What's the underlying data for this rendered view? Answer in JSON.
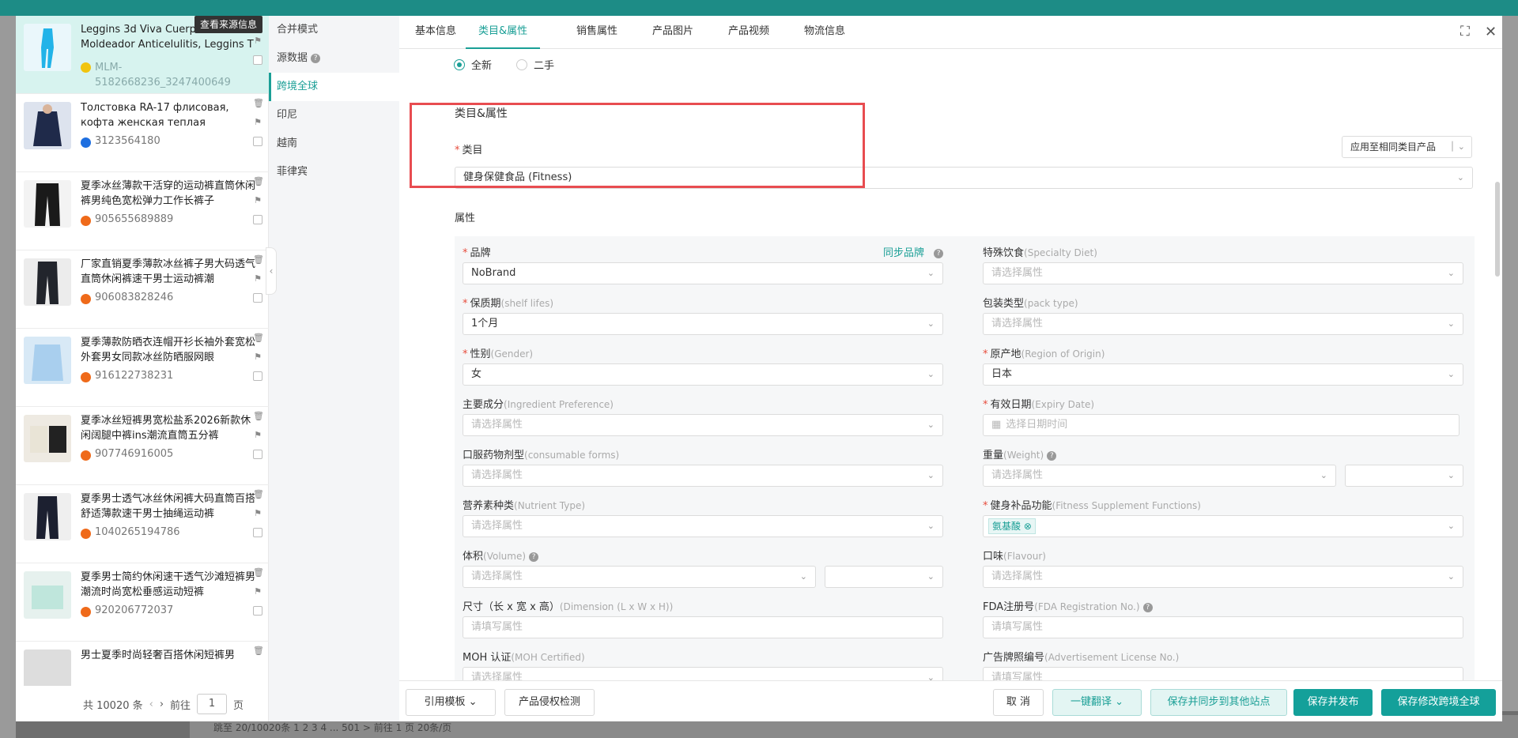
{
  "product_list": {
    "view_source_label": "查看来源信息",
    "items": [
      {
        "title": "Leggins 3d Viva Cuerpo Moldeador Anticelulitis, Leggins T",
        "id": "MLM-5182668236_3247400649",
        "active": true
      },
      {
        "title": "Толстовка RA-17 флисовая, кофта женская теплая",
        "id": "3123564180"
      },
      {
        "title": "夏季冰丝薄款干活穿的运动裤直筒休闲裤男纯色宽松弹力工作长裤子",
        "id": "905655689889"
      },
      {
        "title": "厂家直销夏季薄款冰丝裤子男大码透气直筒休闲裤速干男士运动裤潮",
        "id": "906083828246"
      },
      {
        "title": "夏季薄款防晒衣连帽开衫长袖外套宽松外套男女同款冰丝防晒服网眼",
        "id": "916122738231"
      },
      {
        "title": "夏季冰丝短裤男宽松盐系2026新款休闲阔腿中裤ins潮流直筒五分裤",
        "id": "907746916005"
      },
      {
        "title": "夏季男士透气冰丝休闲裤大码直筒百搭舒适薄款速干男士抽绳运动裤",
        "id": "1040265194786"
      },
      {
        "title": "夏季男士简约休闲速干透气沙滩短裤男潮流时尚宽松垂感运动短裤",
        "id": "920206772037"
      },
      {
        "title": "男士夏季时尚轻奢百搭休闲短裤男",
        "id": ""
      }
    ],
    "pager": {
      "total": "共 10020 条",
      "goto": "前往",
      "page": "1",
      "unit": "页"
    }
  },
  "sites": [
    "合并模式",
    "源数据",
    "跨境全球",
    "印尼",
    "越南",
    "菲律宾"
  ],
  "tabs": [
    "基本信息",
    "类目&属性",
    "销售属性",
    "产品图片",
    "产品视频",
    "物流信息"
  ],
  "condition": {
    "new": "全新",
    "used": "二手"
  },
  "section_title": "类目&属性",
  "category": {
    "label": "类目",
    "apply_button": "应用至相同类目产品",
    "value": "健身保健食品 (Fitness)"
  },
  "attributes_title": "属性",
  "attributes": {
    "brand": {
      "label": "品牌",
      "sync": "同步品牌",
      "value": "NoBrand"
    },
    "special_diet": {
      "label": "特殊饮食",
      "en": "(Specialty Diet)",
      "placeholder": "请选择属性"
    },
    "shelf_life": {
      "label": "保质期",
      "en": "(shelf lifes)",
      "value": "1个月"
    },
    "pack_type": {
      "label": "包装类型",
      "en": "(pack type)",
      "placeholder": "请选择属性"
    },
    "gender": {
      "label": "性别",
      "en": "(Gender)",
      "value": "女"
    },
    "origin": {
      "label": "原产地",
      "en": "(Region of Origin)",
      "value": "日本"
    },
    "ingredient": {
      "label": "主要成分",
      "en": "(Ingredient Preference)",
      "placeholder": "请选择属性"
    },
    "expiry": {
      "label": "有效日期",
      "en": "(Expiry Date)",
      "placeholder": "选择日期时间"
    },
    "consumable": {
      "label": "口服药物剂型",
      "en": "(consumable forms)",
      "placeholder": "请选择属性"
    },
    "weight": {
      "label": "重量",
      "en": "(Weight)",
      "placeholder": "请选择属性"
    },
    "nutrient": {
      "label": "营养素种类",
      "en": "(Nutrient Type)",
      "placeholder": "请选择属性"
    },
    "fitness_fn": {
      "label": "健身补品功能",
      "en": "(Fitness Supplement Functions)",
      "tag": "氨基酸"
    },
    "volume": {
      "label": "体积",
      "en": "(Volume)",
      "placeholder": "请选择属性"
    },
    "flavour": {
      "label": "口味",
      "en": "(Flavour)",
      "placeholder": "请选择属性"
    },
    "dimension": {
      "label": "尺寸（长 x 宽 x 高）",
      "en": "(Dimension (L x W x H))",
      "placeholder": "请填写属性"
    },
    "fda": {
      "label": "FDA注册号",
      "en": "(FDA Registration No.)",
      "placeholder": "请填写属性"
    },
    "moh": {
      "label": "MOH 认证",
      "en": "(MOH Certified)",
      "placeholder": "请选择属性"
    },
    "ad_license": {
      "label": "广告牌照编号",
      "en": "(Advertisement License No.)",
      "placeholder": "请填写属性"
    }
  },
  "footer": {
    "template": "引用模板",
    "check": "产品侵权检测",
    "cancel": "取 消",
    "translate": "一键翻译",
    "save_sync": "保存并同步到其他站点",
    "save_publish": "保存并发布",
    "save_global": "保存修改跨境全球"
  },
  "background": {
    "pagination": "跳至 20/10020条    1  2  3  4  ...  501   >    前往   1   页   20条/页"
  },
  "colors": {
    "accent": "#14a09a",
    "highlight": "#e84c50"
  }
}
